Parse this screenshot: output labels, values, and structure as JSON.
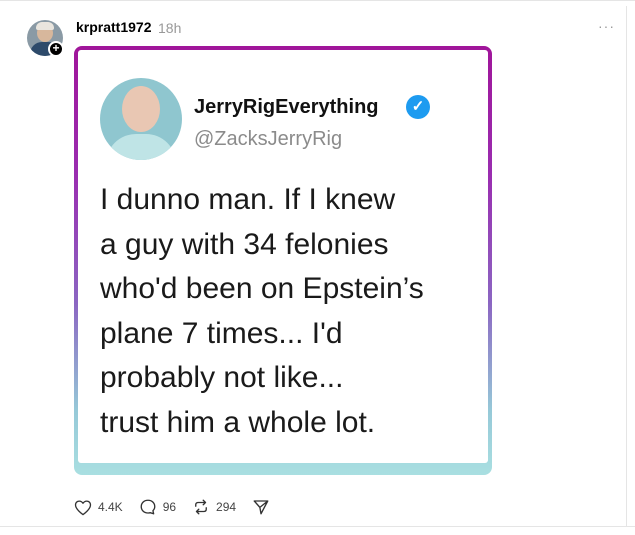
{
  "post": {
    "username": "krpratt1972",
    "time": "18h",
    "more_icon": "more-horizontal-icon"
  },
  "tweet": {
    "name": "JerryRigEverything",
    "handle": "@ZacksJerryRig",
    "text": "I dunno man. If I knew\na guy with 34 felonies\nwho'd been on Epstein’s\nplane 7 times... I'd\nprobably not like...\ntrust him a whole lot."
  },
  "actions": {
    "likes": "4.4K",
    "comments": "96",
    "reposts": "294"
  }
}
